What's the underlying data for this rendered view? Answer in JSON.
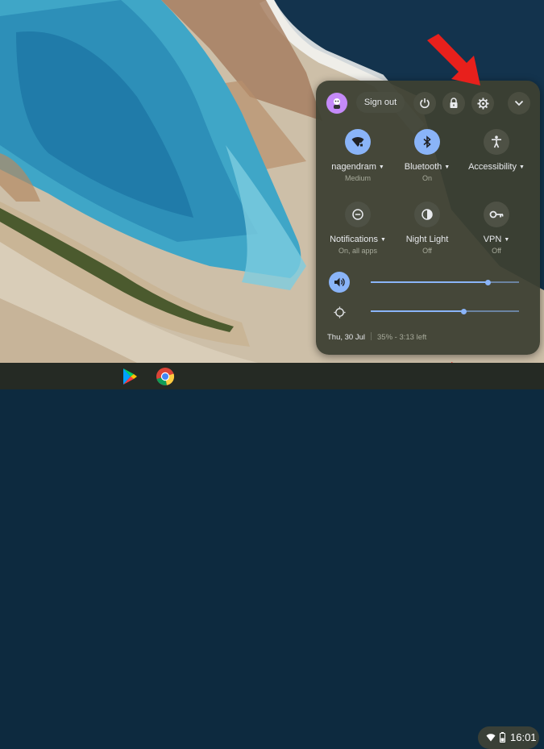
{
  "panel": {
    "sign_out_label": "Sign out",
    "pods_row1": [
      {
        "label": "nagendram",
        "sub": "Medium",
        "icon": "wifi-icon",
        "active": true,
        "caret": true
      },
      {
        "label": "Bluetooth",
        "sub": "On",
        "icon": "bluetooth-icon",
        "active": true,
        "caret": true
      },
      {
        "label": "Accessibility",
        "sub": "",
        "icon": "accessibility-icon",
        "active": false,
        "caret": true
      }
    ],
    "pods_row2": [
      {
        "label": "Notifications",
        "sub": "On, all apps",
        "icon": "notifications-icon",
        "active": false,
        "caret": true
      },
      {
        "label": "Night Light",
        "sub": "Off",
        "icon": "night-light-icon",
        "active": false,
        "caret": false
      },
      {
        "label": "VPN",
        "sub": "Off",
        "icon": "vpn-key-icon",
        "active": false,
        "caret": true
      }
    ],
    "volume_level": 0.79,
    "brightness_level": 0.63,
    "date": "Thu, 30 Jul",
    "battery": "35% - 3:13 left"
  },
  "shelf": {
    "apps": [
      "play-store-icon",
      "chrome-icon"
    ],
    "clock": "16:01"
  },
  "colors": {
    "accent": "#8ab4f8",
    "panel_bg": "#3d4032",
    "arrow": "#e8201c"
  }
}
